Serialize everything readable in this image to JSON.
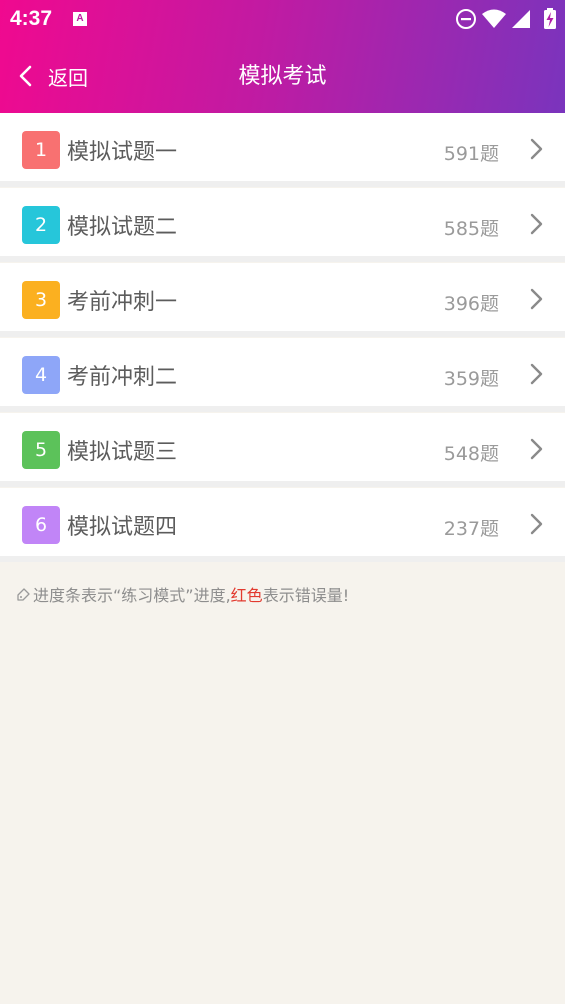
{
  "status_bar": {
    "time": "4:37",
    "notification_icon": "A"
  },
  "nav": {
    "back_label": "返回",
    "title": "模拟考试"
  },
  "items": [
    {
      "index": "1",
      "title": "模拟试题一",
      "count": "591题",
      "color": "#f87171"
    },
    {
      "index": "2",
      "title": "模拟试题二",
      "count": "585题",
      "color": "#26c6da"
    },
    {
      "index": "3",
      "title": "考前冲刺一",
      "count": "396题",
      "color": "#fbb020"
    },
    {
      "index": "4",
      "title": "考前冲刺二",
      "count": "359题",
      "color": "#8ea6f8"
    },
    {
      "index": "5",
      "title": "模拟试题三",
      "count": "548题",
      "color": "#5cc25a"
    },
    {
      "index": "6",
      "title": "模拟试题四",
      "count": "237题",
      "color": "#c185f7"
    }
  ],
  "hint": {
    "text_before": "进度条表示“练习模式”进度,",
    "text_red": "红色",
    "text_after": "表示错误量!"
  },
  "colors": {
    "header_gradient_start": "#f0098f",
    "header_gradient_end": "#7a34bd",
    "background": "#f6f3ed",
    "hint_red": "#e23a2f"
  }
}
